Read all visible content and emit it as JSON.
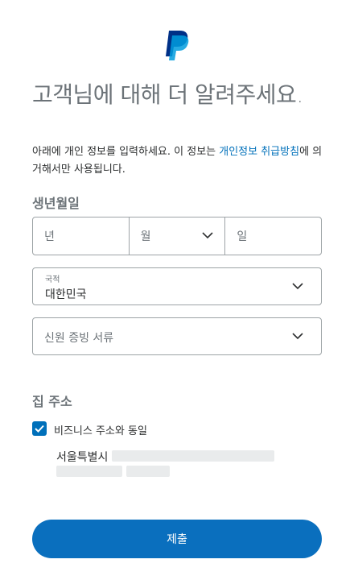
{
  "brand": {
    "logo_icon": "paypal-logo-icon",
    "colors": {
      "primary_blue": "#0070ba",
      "dark_blue": "#003087",
      "light_blue": "#009cde"
    }
  },
  "header": {
    "title": "고객님에 대해 더 알려주세요."
  },
  "intro": {
    "text_before": "아래에 개인 정보를 입력하세요. 이 정보는 ",
    "link": "개인정보 취급방침",
    "text_after": "에 의거해서만 사용됩니다."
  },
  "dob": {
    "title": "생년월일",
    "year_placeholder": "년",
    "month_placeholder": "월",
    "day_placeholder": "일"
  },
  "nationality": {
    "label": "국적",
    "value": "대한민국"
  },
  "id_document": {
    "placeholder": "신원 증빙 서류"
  },
  "home_address": {
    "title": "집 주소",
    "same_as_business_label": "비즈니스 주소와 동일",
    "same_as_business_checked": true,
    "city": "서울특별시"
  },
  "submit": {
    "label": "제출"
  }
}
